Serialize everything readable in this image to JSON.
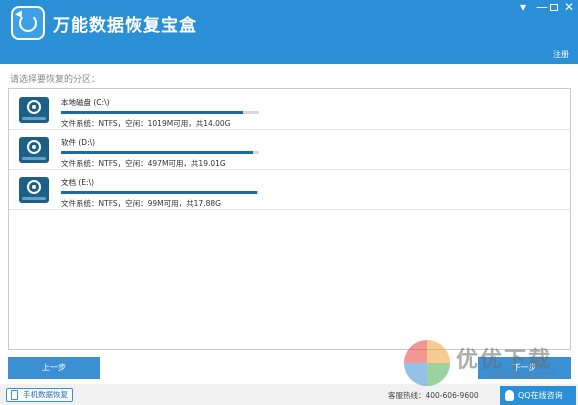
{
  "app": {
    "title": "万能数据恢复宝盒"
  },
  "window": {
    "menu_glyph": "▾",
    "minimize_glyph": "—",
    "close_glyph": "✕"
  },
  "header": {
    "register_label": "注册"
  },
  "prompt": "请选择要恢复的分区：",
  "partitions": [
    {
      "name": "本地磁盘 (C:\\)",
      "info": "文件系统：NTFS，空闲：1019M可用，共14.00G",
      "used_fraction": 0.92
    },
    {
      "name": "软件 (D:\\)",
      "info": "文件系统：NTFS，空闲：497M可用，共19.01G",
      "used_fraction": 0.97
    },
    {
      "name": "文档 (E:\\)",
      "info": "文件系统：NTFS，空闲：99M可用，共17.88G",
      "used_fraction": 0.99
    }
  ],
  "buttons": {
    "prev": "上一步",
    "next": "下一步"
  },
  "footer": {
    "mobile_recovery": "手机数据恢复",
    "hotline": "客服热线：400-606-9600",
    "qq_consult": "QQ在线咨询"
  },
  "watermark": {
    "text": "优优下载",
    "url": "www.yyxt.com"
  },
  "colors": {
    "titlebar": "#2b8fd6",
    "accent": "#3b90d4",
    "bar_fill": "#1c6c99"
  }
}
